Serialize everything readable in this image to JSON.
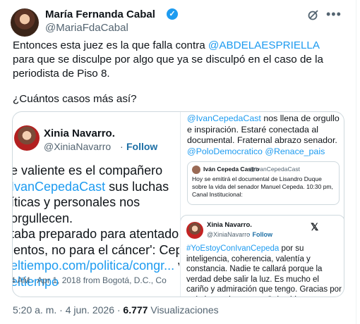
{
  "author": {
    "name": "María Fernanda Cabal",
    "handle": "@MariaFdaCabal"
  },
  "icons": {
    "verified": "verified-badge-icon",
    "grok": "grok-icon",
    "more": "more-icon",
    "x_logo": "x-logo-icon"
  },
  "tweet": {
    "line_prefix": "Entonces esta juez es la que falla contra ",
    "mention": "@ABDELAESPRIELLA",
    "line_suffix": " para que se disculpe por algo que ya se disculpó en el caso de la periodista de Piso 8.",
    "question": "¿Cuántos casos más así?"
  },
  "media_left": {
    "name": "Xinia Navarro.",
    "handle": "@XiniaNavarro",
    "separator": "·",
    "follow": "Follow",
    "lines": [
      {
        "a": "e valiente es el compañero",
        "b": ""
      },
      {
        "a": "",
        "b": "IvanCepedaCast",
        "c": " sus luchas"
      },
      {
        "a": "íticas y personales nos",
        "b": ""
      },
      {
        "a": "orgullecen.",
        "b": ""
      },
      {
        "a": "taba preparado para atentados",
        "b": ""
      },
      {
        "a": "lentos, no para el cáncer': Cepe",
        "b": ""
      },
      {
        "a": "",
        "b": "eltiempo.com/politica/congr...",
        "c": " ví"
      },
      {
        "a": "",
        "b": "eltiempo",
        "c": ""
      }
    ],
    "meta": "4 AM · Apr 1, 2018 from Bogotá, D.C., Co"
  },
  "media_right": {
    "top_mention": "@IvanCepedaCast",
    "top_text": " nos llena de orgullo e inspiración. Estaré conectada al documental. Fraternal abrazo senador.",
    "top_tags": "@PoloDemocratico @Renace_pais",
    "card1": {
      "name": "Iván Cepeda Castro",
      "handle": "@IvanCepedaCast",
      "text": "Hoy se emitirá el documental de Lisandro Duque sobre la vida del senador Manuel Cepeda. 10:30 pm, Canal Institucional:"
    },
    "card2": {
      "name": "Xinia Navarro.",
      "handle": "@XiniaNavarro",
      "separator": "·",
      "follow": "Follow",
      "hashtag": "#YoEstoyConIvanCepeda",
      "text": " por su inteligencia, coherencia, valentía y constancia. Nadie te callará porque la verdad debe salir la luz. Es mucho el cariño y admiración que tengo. Gracias por todo lo que haces por Colombia"
    }
  },
  "footer": {
    "time": "5:20 a. m. · 4 jun. 2026 · ",
    "views": "6.777",
    "views_label": " Visualizaciones"
  }
}
